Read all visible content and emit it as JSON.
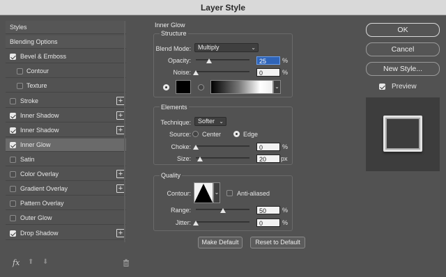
{
  "window": {
    "title": "Layer Style"
  },
  "styles_list": {
    "items": [
      {
        "label": "Styles",
        "kind": "header",
        "checked": null,
        "plus": false
      },
      {
        "label": "Blending Options",
        "kind": "header",
        "checked": null,
        "plus": false
      },
      {
        "label": "Bevel & Emboss",
        "kind": "item",
        "checked": true,
        "plus": false
      },
      {
        "label": "Contour",
        "kind": "sub",
        "checked": false,
        "plus": false
      },
      {
        "label": "Texture",
        "kind": "sub",
        "checked": false,
        "plus": false
      },
      {
        "label": "Stroke",
        "kind": "item",
        "checked": false,
        "plus": true
      },
      {
        "label": "Inner Shadow",
        "kind": "item",
        "checked": true,
        "plus": true
      },
      {
        "label": "Inner Shadow",
        "kind": "item",
        "checked": true,
        "plus": true
      },
      {
        "label": "Inner Glow",
        "kind": "item",
        "checked": true,
        "plus": false,
        "selected": true
      },
      {
        "label": "Satin",
        "kind": "item",
        "checked": false,
        "plus": false
      },
      {
        "label": "Color Overlay",
        "kind": "item",
        "checked": false,
        "plus": true
      },
      {
        "label": "Gradient Overlay",
        "kind": "item",
        "checked": false,
        "plus": true
      },
      {
        "label": "Pattern Overlay",
        "kind": "item",
        "checked": false,
        "plus": false
      },
      {
        "label": "Outer Glow",
        "kind": "item",
        "checked": false,
        "plus": false
      },
      {
        "label": "Drop Shadow",
        "kind": "item",
        "checked": true,
        "plus": true
      }
    ],
    "fx_label": "fx"
  },
  "panel": {
    "title": "Inner Glow",
    "structure": {
      "title": "Structure",
      "blend_mode_label": "Blend Mode:",
      "blend_mode_value": "Multiply",
      "opacity_label": "Opacity:",
      "opacity_value": "25",
      "opacity_level": 0.25,
      "noise_label": "Noise:",
      "noise_value": "0",
      "noise_level": 0,
      "unit_pct": "%"
    },
    "elements": {
      "title": "Elements",
      "technique_label": "Technique:",
      "technique_value": "Softer",
      "source_label": "Source:",
      "source_center": "Center",
      "source_edge": "Edge",
      "source_selected": "Edge",
      "choke_label": "Choke:",
      "choke_value": "0",
      "choke_level": 0,
      "size_label": "Size:",
      "size_value": "20",
      "size_level": 0.08,
      "unit_pct": "%",
      "unit_px": "px"
    },
    "quality": {
      "title": "Quality",
      "contour_label": "Contour:",
      "anti_aliased_label": "Anti-aliased",
      "anti_aliased": false,
      "range_label": "Range:",
      "range_value": "50",
      "range_level": 0.5,
      "jitter_label": "Jitter:",
      "jitter_value": "0",
      "jitter_level": 0,
      "unit_pct": "%"
    },
    "make_default_label": "Make Default",
    "reset_default_label": "Reset to Default"
  },
  "right": {
    "ok_label": "OK",
    "cancel_label": "Cancel",
    "new_style_label": "New Style...",
    "preview_label": "Preview",
    "preview_checked": true
  },
  "colors": {
    "accent": "#2f64b8",
    "background": "#525252",
    "glow_color": "#000000"
  }
}
